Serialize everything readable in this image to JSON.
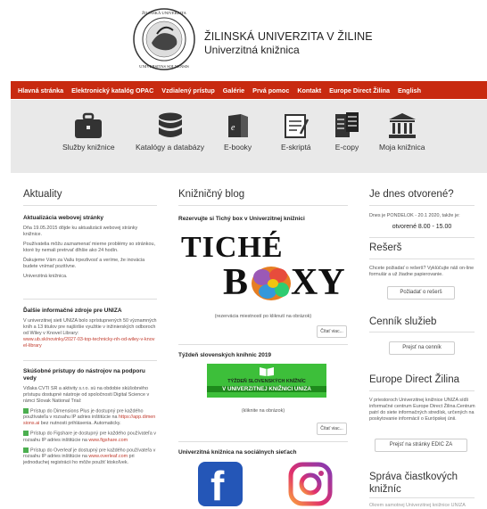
{
  "header": {
    "seal_text": "ŽILINSKÁ UNIVERZITA · UNIVERSITAS SOLNENSIS",
    "university": "ŽILINSKÁ UNIVERZITA V ŽILINE",
    "library": "Univerzitná knižnica"
  },
  "nav": {
    "items": [
      "Hlavná stránka",
      "Elektronický katalóg OPAC",
      "Vzdialený prístup",
      "Galérie",
      "Prvá pomoc",
      "Kontakt",
      "Europe Direct Žilina",
      "English"
    ]
  },
  "icons": {
    "items": [
      {
        "label": "Služby knižnice",
        "icon": "briefcase-icon"
      },
      {
        "label": "Katalógy a databázy",
        "icon": "database-icon"
      },
      {
        "label": "E-booky",
        "icon": "ebook-icon"
      },
      {
        "label": "E-skriptá",
        "icon": "notepad-icon"
      },
      {
        "label": "E-copy",
        "icon": "copy-document-icon"
      },
      {
        "label": "Moja knižnica",
        "icon": "library-building-icon"
      }
    ]
  },
  "news": {
    "title": "Aktuality",
    "item1": {
      "title": "Aktualizácia webovej stránky",
      "p1": "Dňa 19.05.2015 dôjde ku aktualizácii webovej stránky knižnice.",
      "p2": "Používatelia môžu zaznamenať mierne problémy so stránkou, ktoré by nemali pretrvať dlhšie ako 24 hodín.",
      "p3": "Ďakujeme Vám za Vašu trpezlivosť a veríme, že inovácia budete vnímať pozitívne.",
      "p4": "Univerzitná knižnica."
    },
    "item2": {
      "title": "Ďalšie informačné zdroje pre UNIZA",
      "p1": "V univerzitnej sieti UNIZA bolo sprístupnených 50 významných kníh a 13 titulov pre najširšie využitie v inžinierských odboroch od Wiley v Knovel Library:",
      "link": "www.ub.sk/novinky/2027-03-top-technicky-nh-od-wiley-v-knovel-library"
    },
    "item3": {
      "title": "Skúšobné prístupy do nástrojov na podporu vedy",
      "p1": "Vďaka CVTI SR a aktivity s.r.o. sú na obdobie skúšobného prístupu dostupné nástroje od spoločnosti Digital Science v rámci Slovak National Trial:",
      "b1": "Prístup do Dimensions Plus je dostupný pre každého používateľa v rozsahu IP adries inštitúcie na",
      "b1link": "https://app.dimensions.ai",
      "b1end": "bez nutnosti prihlásenia. Automaticky.",
      "b2": "Prístup do Figshare je dostupný pre každého používateľa v rozsahu IP adries inštitúcie na",
      "b2link": "www.figshare.com",
      "b3": "Prístup do Overleaf je dostupný pre každého používateľa v rozsahu IP adries inštitúcie na",
      "b3link": "www.overleaf.com",
      "b3end": "pri jednoduchej registrácii ho môže použiť ktokoľvek."
    }
  },
  "blog": {
    "title": "Knižničný blog",
    "post1": {
      "title": "Rezervujte si Tichý box v Univerzitnej knižnici",
      "img_top": "TICHÉ",
      "img_b": "B",
      "img_xy": "XY",
      "caption": "(rezervácia miestností po kliknutí na obrázok)",
      "more": "Čítať viac..."
    },
    "post2": {
      "title": "Týždeň slovenských kníhnic 2019",
      "banner_line1": "TÝŽDEŇ SLOVENSKÝCH KNÍŽNÍC",
      "banner_line2": "V UNIVERZITNEJ KNIŽNICI UNIZA",
      "caption": "(kliknite na obrázok)",
      "more": "Čítať viac..."
    },
    "post3": {
      "title": "Univerzitná knižnica na sociálnych sieťach"
    }
  },
  "sidebar": {
    "open_title": "Je dnes otvorené?",
    "open_text": "Dnes je PONDELOK - 20.1 2020, takže je:",
    "open_hours": "otvorené 8.00 - 15.00",
    "reserse_title": "Rešerš",
    "reserse_text": "Chcete požiadať o rešerš? Vyklúčujte náš on-line formulár a už žiadne papierovanie.",
    "reserse_btn": "Požiadať o rešerš",
    "cennik_title": "Cenník služieb",
    "cennik_btn": "Prejsť na cenník",
    "edic_title": "Europe Direct Žilina",
    "edic_text": "V priestoroch Univerzitnej knižnice UNIZA sídli informačné centrum Europe Direct Žilina.Centrum patrí do siete informačných stredísk, určených na poskytovanie informácií o Európskej únii.",
    "edic_btn": "Prejsť na stránky EDIC ZA",
    "sprava_title": "Správa čiastkových knižníc",
    "sprava_text": "Okrem samotnej Univerzitnej knižnice UNIZA"
  }
}
